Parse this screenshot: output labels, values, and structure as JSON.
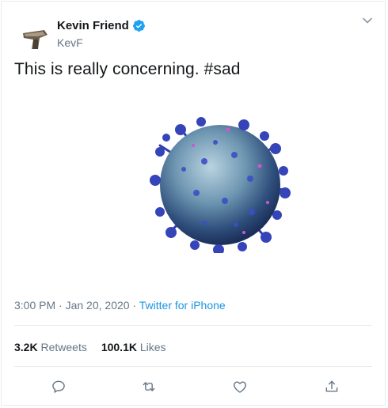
{
  "user": {
    "display_name": "Kevin Friend",
    "handle": "KevF",
    "verified": true
  },
  "tweet": {
    "text": "This is really concerning. #sad",
    "time": "3:00 PM",
    "date": "Jan 20, 2020",
    "source": "Twitter for iPhone"
  },
  "stats": {
    "retweets_count": "3.2K",
    "retweets_label": "Retweets",
    "likes_count": "100.1K",
    "likes_label": "Likes"
  },
  "icons": {
    "verified": "verified-badge-icon",
    "caret": "chevron-down-icon",
    "reply": "reply-icon",
    "retweet": "retweet-icon",
    "like": "heart-icon",
    "share": "share-icon"
  },
  "colors": {
    "brand": "#1da1f2",
    "link": "#1b95e0",
    "muted": "#657786",
    "text": "#14171a"
  }
}
